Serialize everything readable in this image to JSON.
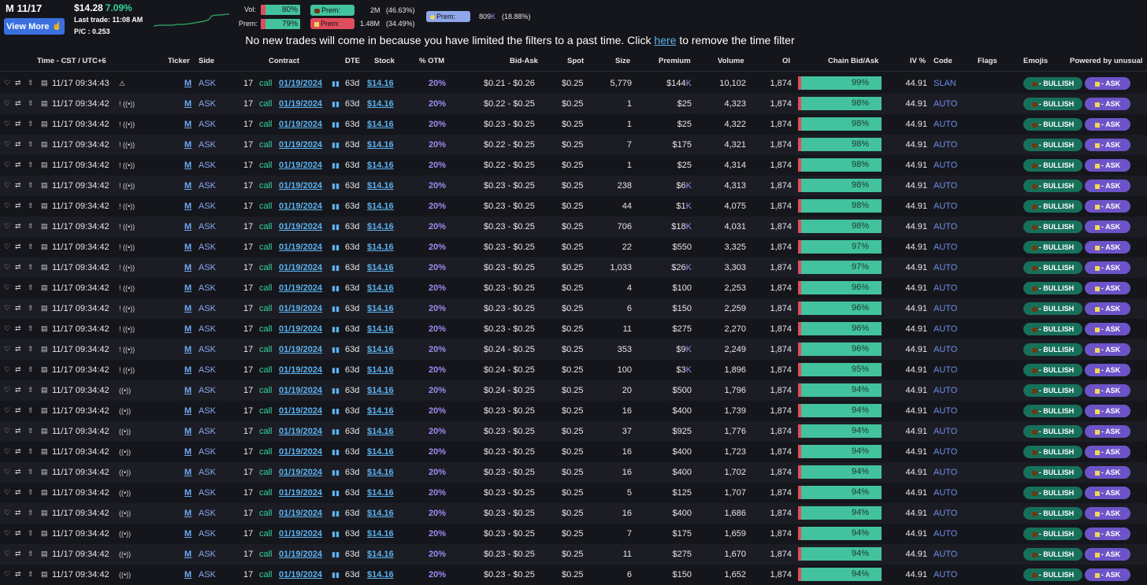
{
  "header": {
    "title": "M 11/17",
    "view_more_label": "View More",
    "price": "$14.28",
    "change": "7.09%",
    "last_trade": "Last trade: 11:08 AM",
    "pc": "P/C : 0.253",
    "vol_label": "Vol:",
    "vol_pct": "80%",
    "vol_red_fraction": 0.12,
    "prem_label": "Prem:",
    "prem_pct": "79%",
    "prem_red_fraction": 0.12,
    "bull_prem_label": "Prem:",
    "bull_prem_value": "2M",
    "bull_prem_pct": "(46.63%)",
    "bear_prem_label": "Prem:",
    "bear_prem_value": "1.48M",
    "bear_prem_pct": "(34.49%)",
    "neutral_prem_label": "Prem:",
    "neutral_prem_value": "809",
    "neutral_prem_unit": "K",
    "neutral_prem_pct": "(18.88%)"
  },
  "notice": {
    "before": "No new trades will come in because you have limited the filters to a past time. Click ",
    "link": "here",
    "after": " to remove the time filter"
  },
  "columns": {
    "time": "Time - CST / UTC+6",
    "ticker": "Ticker",
    "side": "Side",
    "contract": "Contract",
    "dte": "DTE",
    "stock": "Stock",
    "otm": "% OTM",
    "bidask": "Bid-Ask",
    "spot": "Spot",
    "size": "Size",
    "premium": "Premium",
    "volume": "Volume",
    "oi": "OI",
    "chain": "Chain Bid/Ask",
    "iv": "IV %",
    "code": "Code",
    "flags": "Flags",
    "emojis": "Emojis",
    "powered": "Powered by unusual"
  },
  "pills": {
    "bullish": "- BULLISH",
    "ask": "- ASK"
  },
  "rows": [
    {
      "time": "11/17 09:34:43",
      "flag": "⚠",
      "ticker": "M",
      "side": "ASK",
      "strike": "17",
      "type": "call",
      "expiry": "01/19/2024",
      "dte": "63d",
      "stock": "$14.16",
      "otm": "20%",
      "bidask": "$0.21 - $0.26",
      "spot": "$0.25",
      "size": "5,779",
      "premium": "$144",
      "unit": "K",
      "volume": "10,102",
      "oi": "1,874",
      "chain": "99%",
      "iv": "44.91",
      "code": "SLAN"
    },
    {
      "time": "11/17 09:34:42",
      "flag": "! ((•))",
      "ticker": "M",
      "side": "ASK",
      "strike": "17",
      "type": "call",
      "expiry": "01/19/2024",
      "dte": "63d",
      "stock": "$14.16",
      "otm": "20%",
      "bidask": "$0.22 - $0.25",
      "spot": "$0.25",
      "size": "1",
      "premium": "$25",
      "unit": "",
      "volume": "4,323",
      "oi": "1,874",
      "chain": "98%",
      "iv": "44.91",
      "code": "AUTO"
    },
    {
      "time": "11/17 09:34:42",
      "flag": "! ((•))",
      "ticker": "M",
      "side": "ASK",
      "strike": "17",
      "type": "call",
      "expiry": "01/19/2024",
      "dte": "63d",
      "stock": "$14.16",
      "otm": "20%",
      "bidask": "$0.23 - $0.25",
      "spot": "$0.25",
      "size": "1",
      "premium": "$25",
      "unit": "",
      "volume": "4,322",
      "oi": "1,874",
      "chain": "98%",
      "iv": "44.91",
      "code": "AUTO"
    },
    {
      "time": "11/17 09:34:42",
      "flag": "! ((•))",
      "ticker": "M",
      "side": "ASK",
      "strike": "17",
      "type": "call",
      "expiry": "01/19/2024",
      "dte": "63d",
      "stock": "$14.16",
      "otm": "20%",
      "bidask": "$0.22 - $0.25",
      "spot": "$0.25",
      "size": "7",
      "premium": "$175",
      "unit": "",
      "volume": "4,321",
      "oi": "1,874",
      "chain": "98%",
      "iv": "44.91",
      "code": "AUTO"
    },
    {
      "time": "11/17 09:34:42",
      "flag": "! ((•))",
      "ticker": "M",
      "side": "ASK",
      "strike": "17",
      "type": "call",
      "expiry": "01/19/2024",
      "dte": "63d",
      "stock": "$14.16",
      "otm": "20%",
      "bidask": "$0.22 - $0.25",
      "spot": "$0.25",
      "size": "1",
      "premium": "$25",
      "unit": "",
      "volume": "4,314",
      "oi": "1,874",
      "chain": "98%",
      "iv": "44.91",
      "code": "AUTO"
    },
    {
      "time": "11/17 09:34:42",
      "flag": "! ((•))",
      "ticker": "M",
      "side": "ASK",
      "strike": "17",
      "type": "call",
      "expiry": "01/19/2024",
      "dte": "63d",
      "stock": "$14.16",
      "otm": "20%",
      "bidask": "$0.23 - $0.25",
      "spot": "$0.25",
      "size": "238",
      "premium": "$6",
      "unit": "K",
      "volume": "4,313",
      "oi": "1,874",
      "chain": "98%",
      "iv": "44.91",
      "code": "AUTO"
    },
    {
      "time": "11/17 09:34:42",
      "flag": "! ((•))",
      "ticker": "M",
      "side": "ASK",
      "strike": "17",
      "type": "call",
      "expiry": "01/19/2024",
      "dte": "63d",
      "stock": "$14.16",
      "otm": "20%",
      "bidask": "$0.23 - $0.25",
      "spot": "$0.25",
      "size": "44",
      "premium": "$1",
      "unit": "K",
      "volume": "4,075",
      "oi": "1,874",
      "chain": "98%",
      "iv": "44.91",
      "code": "AUTO"
    },
    {
      "time": "11/17 09:34:42",
      "flag": "! ((•))",
      "ticker": "M",
      "side": "ASK",
      "strike": "17",
      "type": "call",
      "expiry": "01/19/2024",
      "dte": "63d",
      "stock": "$14.16",
      "otm": "20%",
      "bidask": "$0.23 - $0.25",
      "spot": "$0.25",
      "size": "706",
      "premium": "$18",
      "unit": "K",
      "volume": "4,031",
      "oi": "1,874",
      "chain": "98%",
      "iv": "44.91",
      "code": "AUTO"
    },
    {
      "time": "11/17 09:34:42",
      "flag": "! ((•))",
      "ticker": "M",
      "side": "ASK",
      "strike": "17",
      "type": "call",
      "expiry": "01/19/2024",
      "dte": "63d",
      "stock": "$14.16",
      "otm": "20%",
      "bidask": "$0.23 - $0.25",
      "spot": "$0.25",
      "size": "22",
      "premium": "$550",
      "unit": "",
      "volume": "3,325",
      "oi": "1,874",
      "chain": "97%",
      "iv": "44.91",
      "code": "AUTO"
    },
    {
      "time": "11/17 09:34:42",
      "flag": "! ((•))",
      "ticker": "M",
      "side": "ASK",
      "strike": "17",
      "type": "call",
      "expiry": "01/19/2024",
      "dte": "63d",
      "stock": "$14.16",
      "otm": "20%",
      "bidask": "$0.23 - $0.25",
      "spot": "$0.25",
      "size": "1,033",
      "premium": "$26",
      "unit": "K",
      "volume": "3,303",
      "oi": "1,874",
      "chain": "97%",
      "iv": "44.91",
      "code": "AUTO"
    },
    {
      "time": "11/17 09:34:42",
      "flag": "! ((•))",
      "ticker": "M",
      "side": "ASK",
      "strike": "17",
      "type": "call",
      "expiry": "01/19/2024",
      "dte": "63d",
      "stock": "$14.16",
      "otm": "20%",
      "bidask": "$0.23 - $0.25",
      "spot": "$0.25",
      "size": "4",
      "premium": "$100",
      "unit": "",
      "volume": "2,253",
      "oi": "1,874",
      "chain": "96%",
      "iv": "44.91",
      "code": "AUTO"
    },
    {
      "time": "11/17 09:34:42",
      "flag": "! ((•))",
      "ticker": "M",
      "side": "ASK",
      "strike": "17",
      "type": "call",
      "expiry": "01/19/2024",
      "dte": "63d",
      "stock": "$14.16",
      "otm": "20%",
      "bidask": "$0.23 - $0.25",
      "spot": "$0.25",
      "size": "6",
      "premium": "$150",
      "unit": "",
      "volume": "2,259",
      "oi": "1,874",
      "chain": "96%",
      "iv": "44.91",
      "code": "AUTO"
    },
    {
      "time": "11/17 09:34:42",
      "flag": "! ((•))",
      "ticker": "M",
      "side": "ASK",
      "strike": "17",
      "type": "call",
      "expiry": "01/19/2024",
      "dte": "63d",
      "stock": "$14.16",
      "otm": "20%",
      "bidask": "$0.23 - $0.25",
      "spot": "$0.25",
      "size": "11",
      "premium": "$275",
      "unit": "",
      "volume": "2,270",
      "oi": "1,874",
      "chain": "96%",
      "iv": "44.91",
      "code": "AUTO"
    },
    {
      "time": "11/17 09:34:42",
      "flag": "! ((•))",
      "ticker": "M",
      "side": "ASK",
      "strike": "17",
      "type": "call",
      "expiry": "01/19/2024",
      "dte": "63d",
      "stock": "$14.16",
      "otm": "20%",
      "bidask": "$0.24 - $0.25",
      "spot": "$0.25",
      "size": "353",
      "premium": "$9",
      "unit": "K",
      "volume": "2,249",
      "oi": "1,874",
      "chain": "96%",
      "iv": "44.91",
      "code": "AUTO"
    },
    {
      "time": "11/17 09:34:42",
      "flag": "! ((•))",
      "ticker": "M",
      "side": "ASK",
      "strike": "17",
      "type": "call",
      "expiry": "01/19/2024",
      "dte": "63d",
      "stock": "$14.16",
      "otm": "20%",
      "bidask": "$0.24 - $0.25",
      "spot": "$0.25",
      "size": "100",
      "premium": "$3",
      "unit": "K",
      "volume": "1,896",
      "oi": "1,874",
      "chain": "95%",
      "iv": "44.91",
      "code": "AUTO"
    },
    {
      "time": "11/17 09:34:42",
      "flag": "((•))",
      "ticker": "M",
      "side": "ASK",
      "strike": "17",
      "type": "call",
      "expiry": "01/19/2024",
      "dte": "63d",
      "stock": "$14.16",
      "otm": "20%",
      "bidask": "$0.24 - $0.25",
      "spot": "$0.25",
      "size": "20",
      "premium": "$500",
      "unit": "",
      "volume": "1,796",
      "oi": "1,874",
      "chain": "94%",
      "iv": "44.91",
      "code": "AUTO"
    },
    {
      "time": "11/17 09:34:42",
      "flag": "((•))",
      "ticker": "M",
      "side": "ASK",
      "strike": "17",
      "type": "call",
      "expiry": "01/19/2024",
      "dte": "63d",
      "stock": "$14.16",
      "otm": "20%",
      "bidask": "$0.23 - $0.25",
      "spot": "$0.25",
      "size": "16",
      "premium": "$400",
      "unit": "",
      "volume": "1,739",
      "oi": "1,874",
      "chain": "94%",
      "iv": "44.91",
      "code": "AUTO"
    },
    {
      "time": "11/17 09:34:42",
      "flag": "((•))",
      "ticker": "M",
      "side": "ASK",
      "strike": "17",
      "type": "call",
      "expiry": "01/19/2024",
      "dte": "63d",
      "stock": "$14.16",
      "otm": "20%",
      "bidask": "$0.23 - $0.25",
      "spot": "$0.25",
      "size": "37",
      "premium": "$925",
      "unit": "",
      "volume": "1,776",
      "oi": "1,874",
      "chain": "94%",
      "iv": "44.91",
      "code": "AUTO"
    },
    {
      "time": "11/17 09:34:42",
      "flag": "((•))",
      "ticker": "M",
      "side": "ASK",
      "strike": "17",
      "type": "call",
      "expiry": "01/19/2024",
      "dte": "63d",
      "stock": "$14.16",
      "otm": "20%",
      "bidask": "$0.23 - $0.25",
      "spot": "$0.25",
      "size": "16",
      "premium": "$400",
      "unit": "",
      "volume": "1,723",
      "oi": "1,874",
      "chain": "94%",
      "iv": "44.91",
      "code": "AUTO"
    },
    {
      "time": "11/17 09:34:42",
      "flag": "((•))",
      "ticker": "M",
      "side": "ASK",
      "strike": "17",
      "type": "call",
      "expiry": "01/19/2024",
      "dte": "63d",
      "stock": "$14.16",
      "otm": "20%",
      "bidask": "$0.23 - $0.25",
      "spot": "$0.25",
      "size": "16",
      "premium": "$400",
      "unit": "",
      "volume": "1,702",
      "oi": "1,874",
      "chain": "94%",
      "iv": "44.91",
      "code": "AUTO"
    },
    {
      "time": "11/17 09:34:42",
      "flag": "((•))",
      "ticker": "M",
      "side": "ASK",
      "strike": "17",
      "type": "call",
      "expiry": "01/19/2024",
      "dte": "63d",
      "stock": "$14.16",
      "otm": "20%",
      "bidask": "$0.23 - $0.25",
      "spot": "$0.25",
      "size": "5",
      "premium": "$125",
      "unit": "",
      "volume": "1,707",
      "oi": "1,874",
      "chain": "94%",
      "iv": "44.91",
      "code": "AUTO"
    },
    {
      "time": "11/17 09:34:42",
      "flag": "((•))",
      "ticker": "M",
      "side": "ASK",
      "strike": "17",
      "type": "call",
      "expiry": "01/19/2024",
      "dte": "63d",
      "stock": "$14.16",
      "otm": "20%",
      "bidask": "$0.23 - $0.25",
      "spot": "$0.25",
      "size": "16",
      "premium": "$400",
      "unit": "",
      "volume": "1,686",
      "oi": "1,874",
      "chain": "94%",
      "iv": "44.91",
      "code": "AUTO"
    },
    {
      "time": "11/17 09:34:42",
      "flag": "((•))",
      "ticker": "M",
      "side": "ASK",
      "strike": "17",
      "type": "call",
      "expiry": "01/19/2024",
      "dte": "63d",
      "stock": "$14.16",
      "otm": "20%",
      "bidask": "$0.23 - $0.25",
      "spot": "$0.25",
      "size": "7",
      "premium": "$175",
      "unit": "",
      "volume": "1,659",
      "oi": "1,874",
      "chain": "94%",
      "iv": "44.91",
      "code": "AUTO"
    },
    {
      "time": "11/17 09:34:42",
      "flag": "((•))",
      "ticker": "M",
      "side": "ASK",
      "strike": "17",
      "type": "call",
      "expiry": "01/19/2024",
      "dte": "63d",
      "stock": "$14.16",
      "otm": "20%",
      "bidask": "$0.23 - $0.25",
      "spot": "$0.25",
      "size": "11",
      "premium": "$275",
      "unit": "",
      "volume": "1,670",
      "oi": "1,874",
      "chain": "94%",
      "iv": "44.91",
      "code": "AUTO"
    },
    {
      "time": "11/17 09:34:42",
      "flag": "((•))",
      "ticker": "M",
      "side": "ASK",
      "strike": "17",
      "type": "call",
      "expiry": "01/19/2024",
      "dte": "63d",
      "stock": "$14.16",
      "otm": "20%",
      "bidask": "$0.23 - $0.25",
      "spot": "$0.25",
      "size": "6",
      "premium": "$150",
      "unit": "",
      "volume": "1,652",
      "oi": "1,874",
      "chain": "94%",
      "iv": "44.91",
      "code": "AUTO"
    }
  ],
  "colors": {
    "bg": "#15161b",
    "green": "#43c29e",
    "red": "#e04d5e",
    "link": "#5bb2f0",
    "purple": "#9b8cf2",
    "bullish_pill": "#17705a",
    "ask_pill": "#6c54c8"
  },
  "icons": [
    "heart-icon",
    "repeat-icon",
    "share-icon",
    "document-icon",
    "warning-icon",
    "broadcast-icon",
    "bull-icon",
    "chart-icon",
    "hand-pointer-icon"
  ]
}
